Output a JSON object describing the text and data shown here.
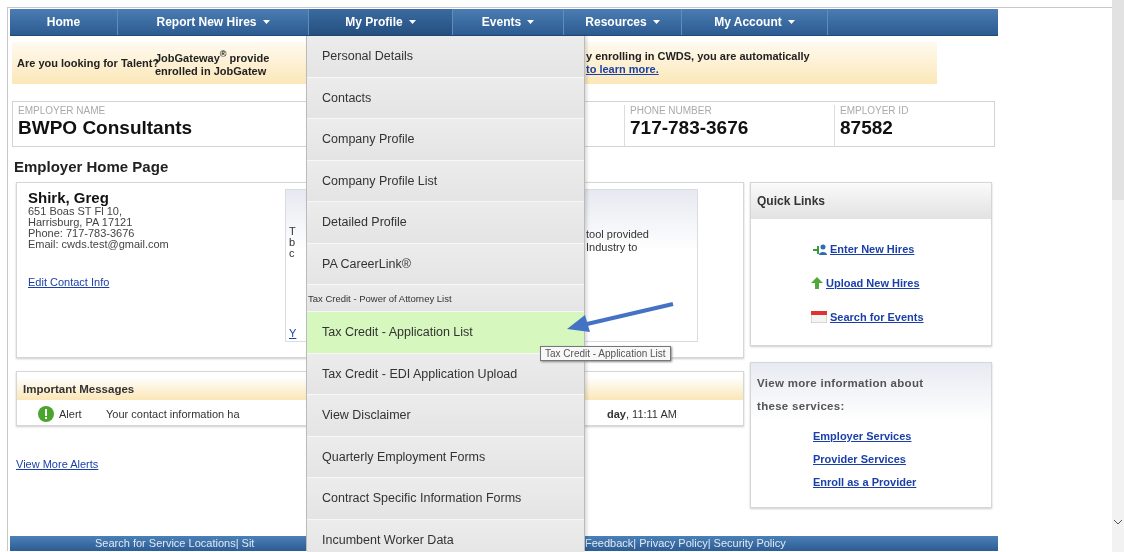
{
  "nav": {
    "items": [
      {
        "label": "Home",
        "has_menu": false,
        "expanded": false
      },
      {
        "label": "Report New Hires",
        "has_menu": true,
        "expanded": false
      },
      {
        "label": "My Profile",
        "has_menu": true,
        "expanded": true
      },
      {
        "label": "Events",
        "has_menu": true,
        "expanded": false
      },
      {
        "label": "Resources",
        "has_menu": true,
        "expanded": false
      },
      {
        "label": "My Account",
        "has_menu": true,
        "expanded": false
      }
    ]
  },
  "banner": {
    "heading": "Are you looking for Talent?",
    "text_left": [
      "JobGateway$^{®}$ provide",
      "enrolled in JobGatew"
    ],
    "text_right": "y enrolling in CWDS, you are automatically",
    "link": "to learn more."
  },
  "employer": {
    "fields": [
      {
        "label": "EMPLOYER NAME",
        "value": "BWPO Consultants"
      },
      {
        "label": "PHONE NUMBER",
        "value": "717-783-3676"
      },
      {
        "label": "EMPLOYER ID",
        "value": "87582"
      }
    ]
  },
  "page_title": "Employer Home Page",
  "contact": {
    "name": "Shirk, Greg",
    "lines": [
      "651 Boas ST Fl 10,",
      "Harrisburg, PA 17121",
      "Phone: 717-783-3676",
      "Email: cwds.test@gmail.com"
    ],
    "link": "Edit Contact Info",
    "panel": {
      "left_fragments": [
        "T",
        "b",
        "c"
      ],
      "left_link": "Y",
      "right_lines": [
        "tool provided",
        "Industry to"
      ]
    }
  },
  "quick_links": {
    "title": "Quick Links",
    "links": [
      {
        "kind": "people",
        "label": "Enter New Hires"
      },
      {
        "kind": "upload",
        "label": "Upload New Hires"
      },
      {
        "kind": "calendar",
        "label": "Search for Events"
      }
    ]
  },
  "messages": {
    "title": "Important Messages",
    "rows": [
      {
        "kind": "alert",
        "type_label": "Alert",
        "text": "Your contact information ha",
        "time": "**day**, 11:11 AM"
      }
    ],
    "more_link": "View More Alerts"
  },
  "services": {
    "title": "View more information about these services:",
    "links": [
      "Employer Services",
      "Provider Services",
      "Enroll as a Provider"
    ]
  },
  "footer": {
    "left": "Search for Service Locations| Sit",
    "right": "Feedback| Privacy Policy| Security Policy"
  },
  "menu": {
    "items": [
      {
        "label": "Personal Details",
        "kind": "normal",
        "selected": false
      },
      {
        "label": "Contacts",
        "kind": "normal",
        "selected": false
      },
      {
        "label": "Company Profile",
        "kind": "normal",
        "selected": false
      },
      {
        "label": "Company Profile List",
        "kind": "normal",
        "selected": false
      },
      {
        "label": "Detailed Profile",
        "kind": "normal",
        "selected": false
      },
      {
        "label": "PA CareerLink®",
        "kind": "normal",
        "selected": false
      },
      {
        "label": "Tax Credit - Power of Attorney List",
        "kind": "compact",
        "selected": false
      },
      {
        "label": "Tax Credit - Application List",
        "kind": "normal",
        "selected": true
      },
      {
        "label": "Tax Credit - EDI Application Upload",
        "kind": "normal",
        "selected": false
      },
      {
        "label": "View Disclaimer",
        "kind": "normal",
        "selected": false
      },
      {
        "label": "Quarterly Employment Forms",
        "kind": "normal",
        "selected": false
      },
      {
        "label": "Contract Specific Information Forms",
        "kind": "normal",
        "selected": false
      },
      {
        "label": "Incumbent Worker Data",
        "kind": "normal",
        "selected": false
      }
    ]
  },
  "tooltip": "Tax Credit - Application List"
}
